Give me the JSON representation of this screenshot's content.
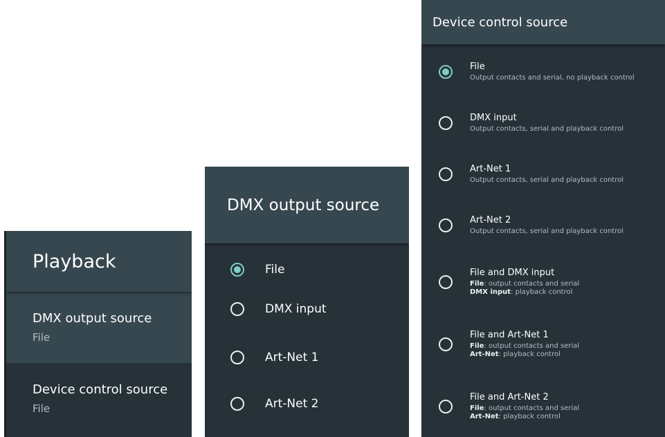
{
  "playback": {
    "title": "Playback",
    "items": [
      {
        "title": "DMX output source",
        "summary": "File"
      },
      {
        "title": "Device control source",
        "summary": "File"
      }
    ]
  },
  "dmx_dialog": {
    "title": "DMX output source",
    "options": [
      "File",
      "DMX input",
      "Art-Net 1",
      "Art-Net 2"
    ],
    "selected": "File"
  },
  "device_dialog": {
    "title": "Device control source",
    "selected": "File",
    "options": [
      {
        "title": "File",
        "sub": "Output contacts and serial, no playback control"
      },
      {
        "title": "DMX input",
        "sub": "Output contacts, serial and playback control"
      },
      {
        "title": "Art-Net 1",
        "sub": "Output contacts, serial and playback control"
      },
      {
        "title": "Art-Net 2",
        "sub": "Output contacts, serial and playback control"
      },
      {
        "title": "File and DMX input",
        "line1_bold": "File",
        "line1_rest": ": output contacts and serial",
        "line2_bold": "DMX input",
        "line2_rest": ": playback control"
      },
      {
        "title": "File and Art-Net 1",
        "line1_bold": "File",
        "line1_rest": ": output contacts and serial",
        "line2_bold": "Art-Net",
        "line2_rest": ": playback control"
      },
      {
        "title": "File and Art-Net 2",
        "line1_bold": "File",
        "line1_rest": ": output contacts and serial",
        "line2_bold": "Art-Net",
        "line2_rest": ": playback control"
      }
    ]
  },
  "colors": {
    "background": "#263238",
    "header": "#37474f",
    "accent": "#80cbc4",
    "secondary_text": "#b0bec5"
  }
}
